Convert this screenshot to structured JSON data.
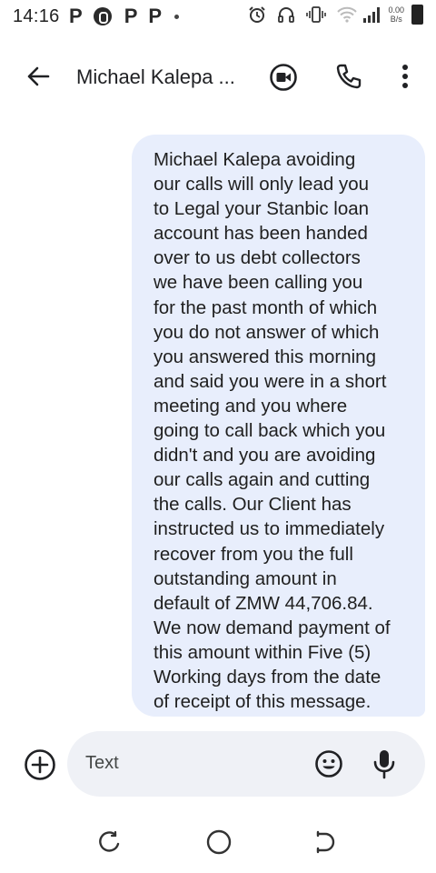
{
  "status_bar": {
    "time": "14:16",
    "net_speed_value": "0.00",
    "net_speed_unit": "B/s",
    "notification_icons": [
      "p-app-icon",
      "shazam-icon",
      "p-app-icon",
      "p-app-icon",
      "more-notifications-dot"
    ],
    "system_icons": [
      "alarm-icon",
      "headset-icon",
      "vibrate-icon",
      "wifi-icon",
      "signal-icon",
      "battery-icon"
    ]
  },
  "app_bar": {
    "contact_name": "Michael Kalepa ...",
    "actions": [
      "back-arrow-icon",
      "video-call-icon",
      "phone-icon",
      "more-vert-icon"
    ]
  },
  "conversation": {
    "messages": [
      {
        "direction": "incoming",
        "text": "Michael Kalepa avoiding\nour calls will only lead you\nto Legal your Stanbic loan\naccount has been handed\nover to us debt collectors\nwe have been calling you\nfor the past month of which\nyou do not answer of which\nyou answered this morning\nand said you were in a short\nmeeting and you where\ngoing to call back which you\ndidn't and you are avoiding\nour calls again and cutting\nthe calls. Our Client has\ninstructed us to immediately\nrecover from you the full\noutstanding amount in\ndefault of ZMW 44,706.84.\nWe now demand payment of\nthis amount within Five (5)\nWorking days from the date\nof receipt of this message."
      }
    ]
  },
  "compose": {
    "placeholder": "Text",
    "icons": [
      "add-circle-icon",
      "emoji-icon",
      "mic-icon"
    ]
  },
  "nav_bar": {
    "icons": [
      "recent-apps-icon",
      "home-icon",
      "back-icon"
    ]
  },
  "colors": {
    "bubble": "#e8eefc",
    "compose_field": "#eff1f6",
    "icon": "#202124"
  }
}
